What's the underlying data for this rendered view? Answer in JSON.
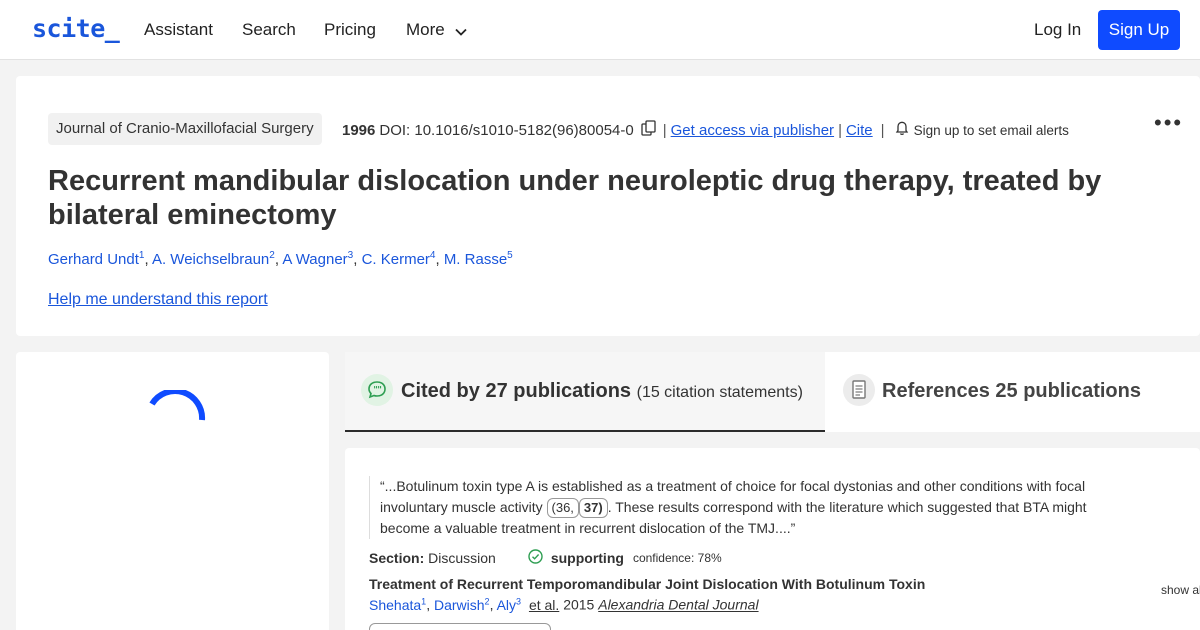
{
  "nav": {
    "logo": "scite_",
    "links": [
      "Assistant",
      "Search",
      "Pricing",
      "More"
    ],
    "login": "Log In",
    "signup": "Sign Up"
  },
  "article": {
    "journal": "Journal of Cranio-Maxillofacial Surgery",
    "year": "1996",
    "doi": "DOI: 10.1016/s1010-5182(96)80054-0",
    "access_link": "Get access via publisher",
    "cite_link": "Cite",
    "alerts": "Sign up to set email alerts",
    "title": "Recurrent mandibular dislocation under neuroleptic drug therapy, treated by bilateral eminectomy",
    "authors": [
      {
        "name": "Gerhard Undt",
        "n": "1"
      },
      {
        "name": "A. Weichselbraun",
        "n": "2"
      },
      {
        "name": "A Wagner",
        "n": "3"
      },
      {
        "name": "C. Kermer",
        "n": "4"
      },
      {
        "name": "M. Rasse",
        "n": "5"
      }
    ],
    "help_link": "Help me understand this report"
  },
  "tabs": {
    "cited_main": "Cited by 27 publications",
    "cited_sub": "(15 citation statements)",
    "refs_main": "References 25 publications"
  },
  "citation": {
    "quote_start": "“...Botulinum toxin type A is established as a treatment of choice for focal dystonias and other conditions with focal involuntary muscle activity ",
    "ref1": "(36,",
    "ref2": "37)",
    "quote_end": ". These results correspond with the literature which suggested that BTA might become a valuable treatment in recurrent dislocation of the TMJ....”",
    "section_label": "Section:",
    "section_value": "Discussion",
    "classification": "supporting",
    "confidence": "confidence: 78%",
    "paper_title": "Treatment of Recurrent Temporomandibular Joint Dislocation With Botulinum Toxin",
    "paper_authors": [
      {
        "name": "Shehata",
        "n": "1"
      },
      {
        "name": "Darwish",
        "n": "2"
      },
      {
        "name": "Aly",
        "n": "3"
      }
    ],
    "etal": "et al.",
    "paper_year": "2015",
    "paper_journal": "Alexandria Dental Journal",
    "show_all": "show all"
  },
  "colors": {
    "accent": "#1a56db",
    "button": "#0f4bff",
    "supporting": "#2e9e52"
  }
}
